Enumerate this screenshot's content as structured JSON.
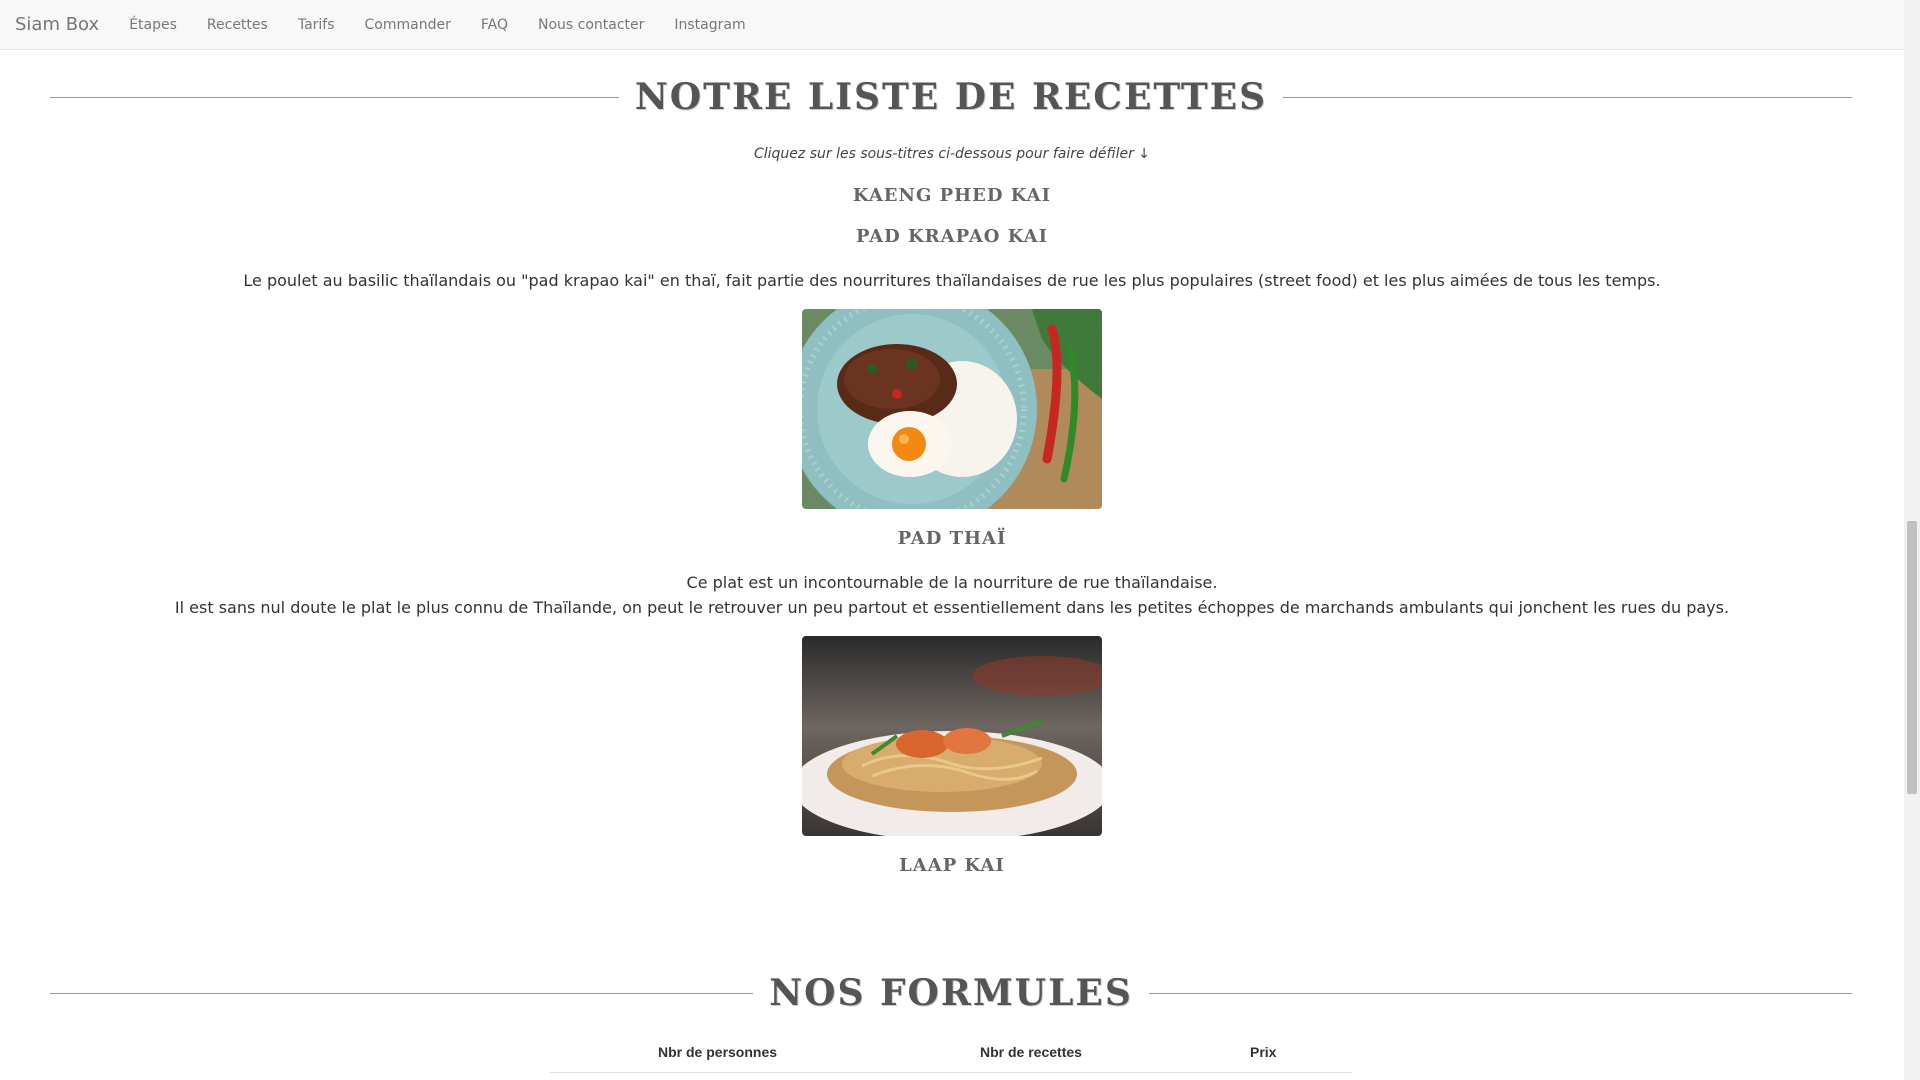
{
  "navbar": {
    "brand": "Siam Box",
    "items": [
      {
        "label": "Étapes"
      },
      {
        "label": "Recettes"
      },
      {
        "label": "Tarifs"
      },
      {
        "label": "Commander"
      },
      {
        "label": "FAQ"
      },
      {
        "label": "Nous contacter"
      },
      {
        "label": "Instagram"
      }
    ]
  },
  "recettes": {
    "title": "NOTRE LISTE DE RECETTES",
    "hint": "Cliquez sur les sous-titres ci-dessous pour faire défiler ↓",
    "items": [
      {
        "title": "KAENG PHED KAI"
      },
      {
        "title": "PAD KRAPAO KAI",
        "description": "Le poulet au basilic thaïlandais ou \"pad krapao kai\" en thaï, fait partie des nourritures thaïlandaises de rue les plus populaires (street food) et les plus aimées de tous les temps."
      },
      {
        "title": "PAD THAÏ",
        "description_line1": "Ce plat est un incontournable de la nourriture de rue thaïlandaise.",
        "description_line2": "Il est sans nul doute le plat le plus connu de Thaïlande, on peut le retrouver un peu partout et essentiellement dans les petites échoppes de marchands ambulants qui jonchent les rues du pays."
      },
      {
        "title": "LAAP KAI"
      }
    ]
  },
  "formules": {
    "title": "NOS FORMULES",
    "columns": [
      "Nbr de personnes",
      "Nbr de recettes",
      "Prix"
    ]
  }
}
